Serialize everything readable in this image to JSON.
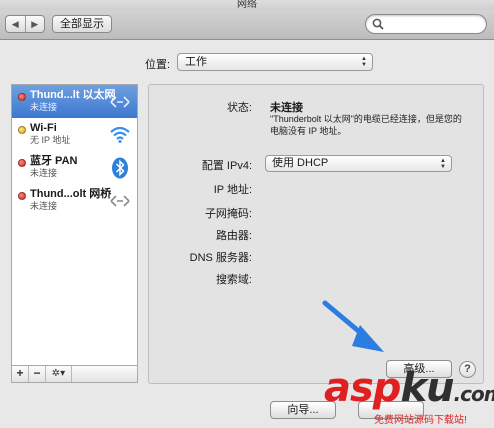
{
  "window": {
    "title": "网络"
  },
  "toolbar": {
    "back": "◀",
    "forward": "▶",
    "show_all": "全部显示"
  },
  "location": {
    "label": "位置:",
    "value": "工作"
  },
  "services": [
    {
      "name": "Thund...lt 以太网",
      "status": "未连接",
      "icon": "ethernet-arrows-icon",
      "dot": "red",
      "selected": true
    },
    {
      "name": "Wi-Fi",
      "status": "无 IP 地址",
      "icon": "wifi-icon",
      "dot": "yellow",
      "selected": false
    },
    {
      "name": "蓝牙 PAN",
      "status": "未连接",
      "icon": "bluetooth-icon",
      "dot": "red",
      "selected": false
    },
    {
      "name": "Thund...olt 网桥",
      "status": "未连接",
      "icon": "bridge-arrows-icon",
      "dot": "red",
      "selected": false
    }
  ],
  "sidebar_buttons": {
    "add": "+",
    "remove": "−",
    "gear": "✲▾"
  },
  "detail": {
    "status_label": "状态:",
    "status_value": "未连接",
    "status_desc": "\"Thunderbolt 以太网\"的电缆已经连接，但是您的电脑没有 IP 地址。",
    "configure_label": "配置 IPv4:",
    "configure_value": "使用 DHCP",
    "ip_label": "IP 地址:",
    "subnet_label": "子网掩码:",
    "router_label": "路由器:",
    "dns_label": "DNS 服务器:",
    "search_domains_label": "搜索域:"
  },
  "buttons": {
    "advanced": "高级...",
    "help": "?",
    "assistant": "向导..."
  },
  "watermark": {
    "logo_a": "asp",
    "logo_b": "ku",
    "logo_c": ".com",
    "tagline": "免费网站源码下载站!"
  },
  "colors": {
    "selection": "#3d78cf",
    "arrow": "#2b7de0",
    "watermark": "#e02020"
  }
}
